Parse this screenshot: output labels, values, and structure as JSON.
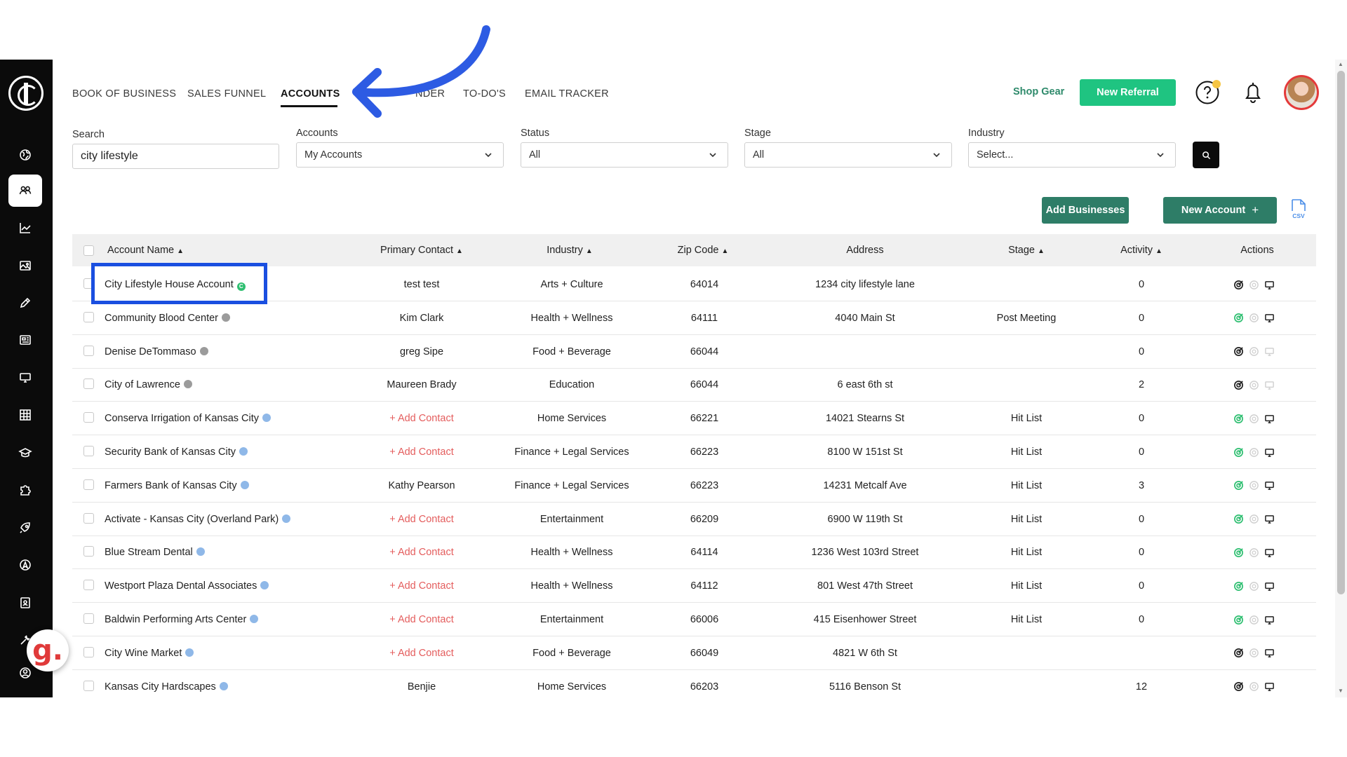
{
  "nav": {
    "tabs": [
      {
        "label": "BOOK OF BUSINESS"
      },
      {
        "label": "SALES FUNNEL"
      },
      {
        "label": "ACCOUNTS"
      },
      {
        "label": "NDER"
      },
      {
        "label": "TO-DO'S"
      },
      {
        "label": "EMAIL TRACKER"
      }
    ],
    "active_tab": "ACCOUNTS",
    "shop_gear": "Shop Gear",
    "new_referral": "New Referral"
  },
  "sidebar": {
    "icons": [
      "logo-icon",
      "globe-icon",
      "users-icon",
      "chart-icon",
      "image-icon",
      "pencil-icon",
      "newspaper-icon",
      "monitor-icon",
      "grid-icon",
      "graduation-cap-icon",
      "puzzle-icon",
      "rocket-icon",
      "compass-icon",
      "contact-card-icon",
      "tools-icon",
      "user-circle-icon"
    ],
    "active": "users-icon"
  },
  "filters": {
    "search": {
      "label": "Search",
      "value": "city lifestyle"
    },
    "accounts": {
      "label": "Accounts",
      "value": "My Accounts"
    },
    "status": {
      "label": "Status",
      "value": "All"
    },
    "stage": {
      "label": "Stage",
      "value": "All"
    },
    "industry": {
      "label": "Industry",
      "value": "Select..."
    }
  },
  "buttons": {
    "add_businesses": "Add Businesses",
    "new_account": "New Account",
    "new_account_plus": "+",
    "csv_label": "CSV"
  },
  "table": {
    "columns": {
      "account_name": "Account Name",
      "primary_contact": "Primary Contact",
      "industry": "Industry",
      "zip_code": "Zip Code",
      "address": "Address",
      "stage": "Stage",
      "activity": "Activity",
      "actions": "Actions"
    },
    "sort_arrow": "▲",
    "rows": [
      {
        "name": "City Lifestyle House Account",
        "badge": "green",
        "contact": "test test",
        "contact_is_add": false,
        "industry": "Arts + Culture",
        "zip": "64014",
        "address": "1234 city lifestyle lane",
        "stage": "",
        "activity": "0",
        "action_icons": [
          "target-dark",
          "circle-light",
          "monitor-dark"
        ]
      },
      {
        "name": "Community Blood Center",
        "badge": "gray",
        "contact": "Kim Clark",
        "contact_is_add": false,
        "industry": "Health + Wellness",
        "zip": "64111",
        "address": "4040 Main St",
        "stage": "Post Meeting",
        "activity": "0",
        "action_icons": [
          "target-green",
          "circle-light",
          "monitor-dark"
        ]
      },
      {
        "name": "Denise DeTommaso",
        "badge": "gray",
        "contact": "greg Sipe",
        "contact_is_add": false,
        "industry": "Food + Beverage",
        "zip": "66044",
        "address": "",
        "stage": "",
        "activity": "0",
        "action_icons": [
          "target-dark",
          "circle-light",
          "monitor-light"
        ]
      },
      {
        "name": "City of Lawrence",
        "badge": "gray",
        "contact": "Maureen Brady",
        "contact_is_add": false,
        "industry": "Education",
        "zip": "66044",
        "address": "6 east 6th st",
        "stage": "",
        "activity": "2",
        "action_icons": [
          "target-dark",
          "circle-light",
          "monitor-light"
        ]
      },
      {
        "name": "Conserva Irrigation of Kansas City",
        "badge": "blue",
        "contact": "+ Add Contact",
        "contact_is_add": true,
        "industry": "Home Services",
        "zip": "66221",
        "address": "14021 Stearns St",
        "stage": "Hit List",
        "activity": "0",
        "action_icons": [
          "target-green",
          "circle-light",
          "monitor-dark"
        ]
      },
      {
        "name": "Security Bank of Kansas City",
        "badge": "blue",
        "contact": "+ Add Contact",
        "contact_is_add": true,
        "industry": "Finance + Legal Services",
        "zip": "66223",
        "address": "8100 W 151st St",
        "stage": "Hit List",
        "activity": "0",
        "action_icons": [
          "target-green",
          "circle-light",
          "monitor-dark"
        ]
      },
      {
        "name": "Farmers Bank of Kansas City",
        "badge": "blue",
        "contact": "Kathy Pearson",
        "contact_is_add": false,
        "industry": "Finance + Legal Services",
        "zip": "66223",
        "address": "14231 Metcalf Ave",
        "stage": "Hit List",
        "activity": "3",
        "action_icons": [
          "target-green",
          "circle-light",
          "monitor-dark"
        ]
      },
      {
        "name": "Activate - Kansas City (Overland Park)",
        "badge": "blue",
        "contact": "+ Add Contact",
        "contact_is_add": true,
        "industry": "Entertainment",
        "zip": "66209",
        "address": "6900 W 119th St",
        "stage": "Hit List",
        "activity": "0",
        "action_icons": [
          "target-green",
          "circle-light",
          "monitor-dark"
        ]
      },
      {
        "name": "Blue Stream Dental",
        "badge": "blue",
        "contact": "+ Add Contact",
        "contact_is_add": true,
        "industry": "Health + Wellness",
        "zip": "64114",
        "address": "1236 West 103rd Street",
        "stage": "Hit List",
        "activity": "0",
        "action_icons": [
          "target-green",
          "circle-light",
          "monitor-dark"
        ]
      },
      {
        "name": "Westport Plaza Dental Associates",
        "badge": "blue",
        "contact": "+ Add Contact",
        "contact_is_add": true,
        "industry": "Health + Wellness",
        "zip": "64112",
        "address": "801 West 47th Street",
        "stage": "Hit List",
        "activity": "0",
        "action_icons": [
          "target-green",
          "circle-light",
          "monitor-dark"
        ]
      },
      {
        "name": "Baldwin Performing Arts Center",
        "badge": "blue",
        "contact": "+ Add Contact",
        "contact_is_add": true,
        "industry": "Entertainment",
        "zip": "66006",
        "address": "415 Eisenhower Street",
        "stage": "Hit List",
        "activity": "0",
        "action_icons": [
          "target-green",
          "circle-light",
          "monitor-dark"
        ]
      },
      {
        "name": "City Wine Market",
        "badge": "blue",
        "contact": "+ Add Contact",
        "contact_is_add": true,
        "industry": "Food + Beverage",
        "zip": "66049",
        "address": "4821 W 6th St",
        "stage": "",
        "activity": "",
        "action_icons": [
          "target-dark",
          "circle-light",
          "monitor-dark"
        ]
      },
      {
        "name": "Kansas City Hardscapes",
        "badge": "blue",
        "contact": "Benjie",
        "contact_is_add": false,
        "industry": "Home Services",
        "zip": "66203",
        "address": "5116 Benson St",
        "stage": "",
        "activity": "12",
        "action_icons": [
          "target-dark",
          "circle-light",
          "monitor-dark"
        ]
      }
    ]
  },
  "badge_colors": {
    "green": "#2fbf71",
    "gray": "#9b9b9b",
    "blue": "#8fb8e8"
  },
  "colors": {
    "accent_green": "#1fc481",
    "button_green": "#2e7d67",
    "add_contact_red": "#e45d5d",
    "highlight_blue": "#1a4fe0",
    "arrow_blue": "#2d5be3"
  },
  "overlay": {
    "brand_letter": "g."
  }
}
